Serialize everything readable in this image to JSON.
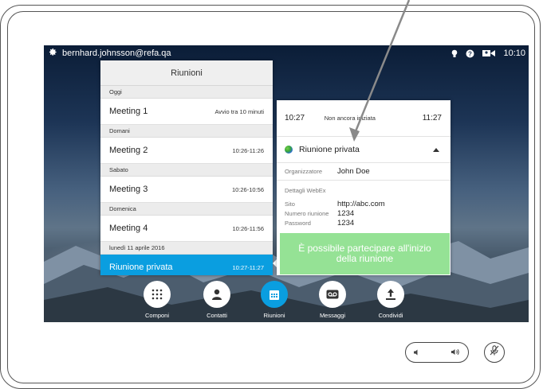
{
  "status_bar": {
    "username": "bernhard.johnsson@refa.qa",
    "settings_icon": "gear-icon",
    "icons": [
      "lightbulb-icon",
      "help-icon",
      "camera-icon"
    ],
    "time": "10:10"
  },
  "meetings_panel": {
    "title": "Riunioni",
    "groups": [
      {
        "day": "Oggi",
        "meeting": {
          "title": "Meeting 1",
          "time": "Avvio tra 10 minuti"
        }
      },
      {
        "day": "Domani",
        "meeting": {
          "title": "Meeting 2",
          "time": "10:26-11:26"
        }
      },
      {
        "day": "Sabato",
        "meeting": {
          "title": "Meeting 3",
          "time": "10:26-10:56"
        }
      },
      {
        "day": "Domenica",
        "meeting": {
          "title": "Meeting 4",
          "time": "10:26-11:56"
        }
      },
      {
        "day": "lunedì 11 aprile 2016",
        "meeting": {
          "title": "Riunione privata",
          "time": "10:27-11:27",
          "selected": true
        }
      }
    ]
  },
  "detail_panel": {
    "start_time": "10:27",
    "status": "Non ancora iniziata",
    "end_time": "11:27",
    "title": "Riunione privata",
    "organizer_label": "Organizzatore",
    "organizer": "John Doe",
    "webex_label": "Dettagli WebEx",
    "site_label": "Sito",
    "site": "http://abc.com",
    "meeting_number_label": "Numero riunione",
    "meeting_number": "1234",
    "password_label": "Password",
    "password": "1234"
  },
  "toast": {
    "message": "È possibile partecipare all'inizio della riunione"
  },
  "toolbar": {
    "items": [
      {
        "label": "Componi",
        "icon": "keypad-icon"
      },
      {
        "label": "Contatti",
        "icon": "person-icon"
      },
      {
        "label": "Riunioni",
        "icon": "calendar-icon",
        "active": true
      },
      {
        "label": "Messaggi",
        "icon": "voicemail-icon"
      },
      {
        "label": "Condividi",
        "icon": "share-icon"
      }
    ]
  },
  "device_controls": {
    "volume_down_icon": "volume-down-icon",
    "volume_up_icon": "volume-up-icon",
    "mute_icon": "microphone-mute-icon"
  },
  "colors": {
    "accent": "#0a9ee0",
    "toast": "#8ce08c"
  }
}
